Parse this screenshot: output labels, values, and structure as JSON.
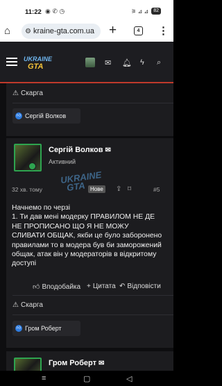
{
  "status": {
    "time": "11:22",
    "icons": "◉ ✆ ◷",
    "signal": "⚞ ⊿ ⊿",
    "battery": "82"
  },
  "browser": {
    "url": "kraine-gta.com.ua",
    "tab_count": "4"
  },
  "site": {
    "logo_line1": "UKRAINE",
    "logo_line2": "GTA"
  },
  "post_prev": {
    "report_label": "Скарга",
    "likes_user": "Сергій Волков"
  },
  "post": {
    "username": "Сергій Волков",
    "user_title": "Активний",
    "time": "32 хв. тому",
    "new_badge": "Нове",
    "number": "#5",
    "text": "Начнемо по черзі\n1. Ти дав мені модерку ПРАВИЛОМ НЕ ДЕ НЕ ПРОПИСАНО ЩО Я НЕ МОЖУ СЛИВАТИ ОБЩАК, якби це було заборонено правилами то в модера був би заморожений общак, атак він у модераторів в відкритому доступі",
    "like_label": "Вподобайка",
    "quote_label": "Цитата",
    "reply_label": "Відповісти",
    "report_label": "Скарга",
    "likes_user": "Гром Роберт"
  },
  "next_post": {
    "username": "Гром Роберт"
  }
}
